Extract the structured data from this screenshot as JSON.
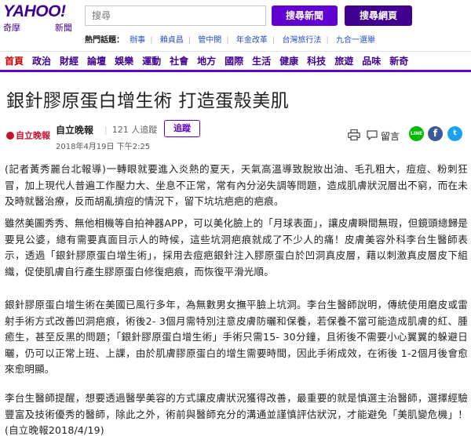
{
  "header": {
    "logo_text": "YAHOO!",
    "logo_sub": "奇摩",
    "logo_section": "新聞",
    "search_placeholder": "搜尋",
    "search_news_btn": "搜尋新聞",
    "search_web_btn": "搜尋網頁",
    "hot_title": "熱門話題：",
    "hot_topics": [
      "辦事",
      "賴貞昌",
      "管中閔",
      "年金改革",
      "台灣旅行法",
      "九合一選舉"
    ]
  },
  "nav": {
    "items": [
      "首頁",
      "政治",
      "財經",
      "論壇",
      "娛樂",
      "運動",
      "社會",
      "地方",
      "國際",
      "生活",
      "健康",
      "科技",
      "旅遊",
      "品味",
      "新奇"
    ],
    "active_index": 0
  },
  "article": {
    "title": "銀針膠原蛋白增生術 打造蛋殼美肌",
    "source_logo": "自立晚報",
    "source_name": "自立晚報",
    "readers": "121 人追蹤",
    "follow_btn": "追蹤",
    "date": "2018年4月19日 下午2:25",
    "comment_label": "留言",
    "share_line": "LINE",
    "share_fb": "f",
    "share_tw": "t",
    "paragraphs": [
      "(記者黃秀麗台北報導)一轉眼就要進入炎熱的夏天，天氣高溫導致脫妝出油、毛孔粗大，痘痘、粉刺狂冒，加上現代人普遍工作壓力大、坐息不正常，常有內分泌失調等問題，造成肌膚狀況層出不窮，而在未及時就醫治療，反而胡亂擠痘的情況下，留下坑坑疤疤的疤痕。",
      "雖然美圖秀秀、無他相機等自拍神器APP，可以美化臉上的「月球表面」，讓皮膚瞬間無瑕，但鏡頭總歸是要見公婆，總有需要真面目示人的時候，這些坑洞疤痕就成了不少人的痛！皮膚美容外科李台生醫師表示，透過「銀針膠原蛋白增生術」，採用去痘疤銀針注入膠原蛋白於凹洞真皮層，藉以刺激真皮層皮下組織，促使肌膚自行產生膠原蛋白修復疤痕，而恢復平滑光順。",
      "銀針膠原蛋白增生術在美國已風行多年，為無數男女撫平臉上坑洞。李台生醫師說明，傳統使用磨皮或雷射手術方式改善凹洞疤痕，術後2- 3個月需特別注意皮膚防曬和保養，若保養不當可能造成肌膚的紅、腫癒生，甚至反黑的問題；「銀針膠原蛋白增生術」手術只需15- 30分鐘，且術後不需要小心翼翼的躲避日曬，仍可以正常上班、上課，由於肌膚膠原蛋白的增生需要時間，因此手術成效，在術後 1-2個月後會愈來愈明顯。",
      "李台生醫師提醒，想要透過醫學美容的方式讓皮膚狀況獲得改善，最重要的就是慎選主治醫師，選擇經驗豐富及技術優秀的醫師，除此之外，術前與醫師充分的溝通並謹慎評估狀況，才能避免「美肌變危機」！(自立晚報2018/4/19)"
    ]
  },
  "colors": {
    "brand_purple": "#400090",
    "button_purple": "#6001d2",
    "active_red": "#cc0000",
    "link_blue": "#2a4cc5",
    "line_green": "#00b900",
    "fb_blue": "#3b5998",
    "tw_blue": "#1da1f2"
  },
  "icons": {
    "print": "printer-icon",
    "comment": "comment-icon"
  }
}
